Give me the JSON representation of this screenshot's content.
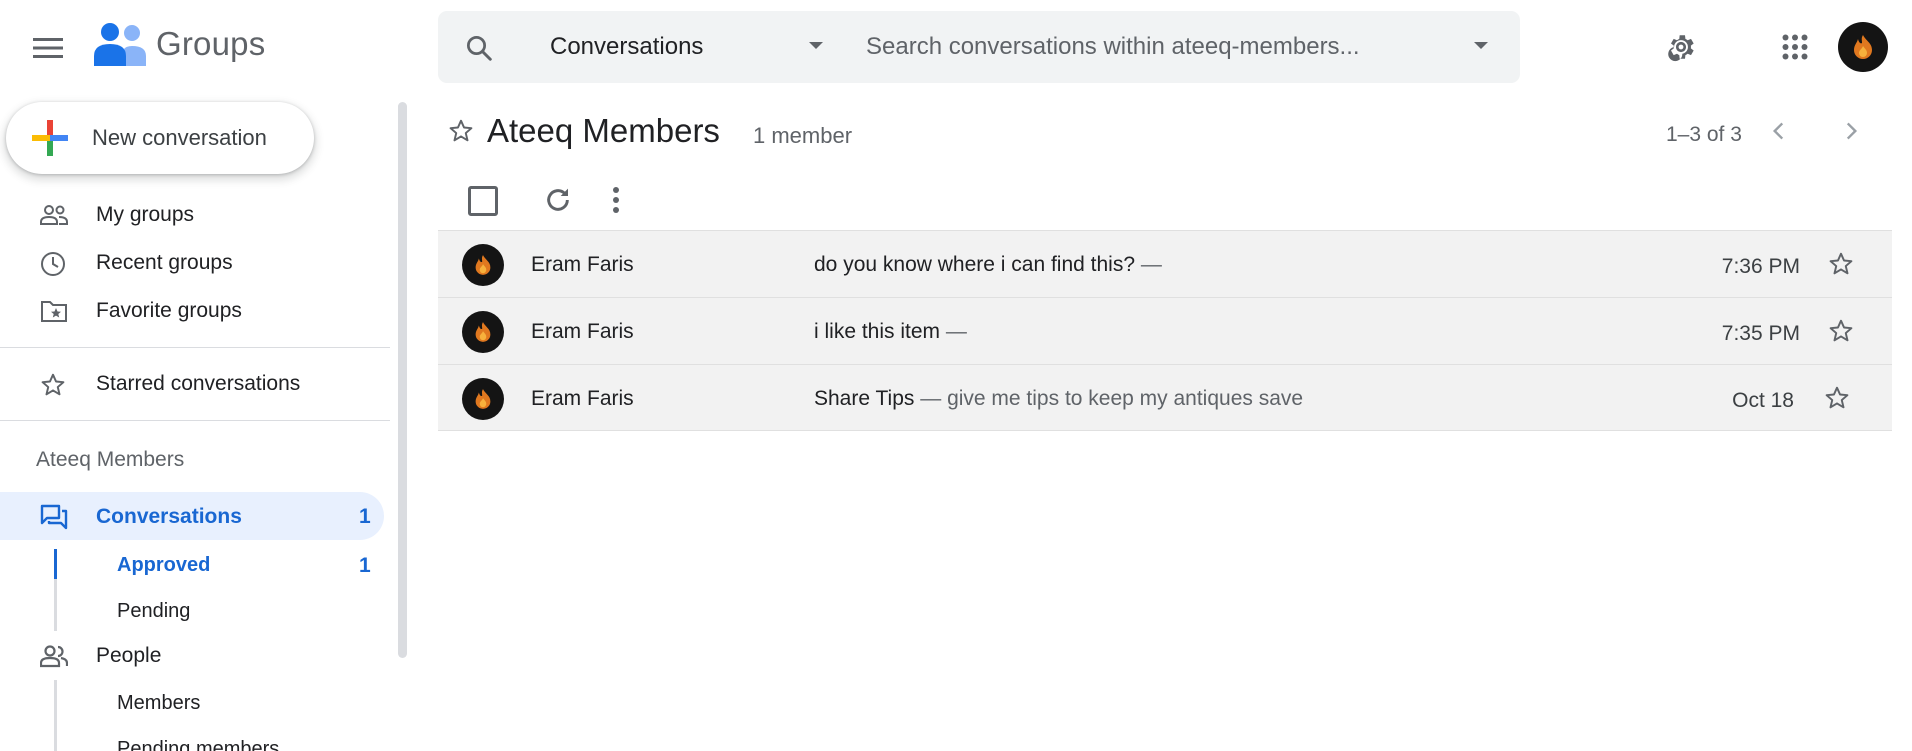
{
  "header": {
    "app_name": "Groups",
    "search_scope": "Conversations",
    "search_placeholder": "Search conversations within ateeq-members..."
  },
  "sidebar": {
    "new_conversation_label": "New conversation",
    "nav": [
      {
        "label": "My groups",
        "icon": "people-icon"
      },
      {
        "label": "Recent groups",
        "icon": "clock-icon"
      },
      {
        "label": "Favorite groups",
        "icon": "folder-star-icon"
      },
      {
        "label": "Starred conversations",
        "icon": "star-outline-icon"
      }
    ],
    "group_section_label": "Ateeq Members",
    "conversations": {
      "label": "Conversations",
      "count": "1"
    },
    "conversation_sub": [
      {
        "label": "Approved",
        "count": "1"
      },
      {
        "label": "Pending"
      }
    ],
    "people_label": "People",
    "people_sub": [
      {
        "label": "Members"
      },
      {
        "label": "Pending members"
      }
    ]
  },
  "main": {
    "group_title": "Ateeq Members",
    "member_count": "1 member",
    "pagination": "1–3 of 3",
    "threads": [
      {
        "author": "Eram Faris",
        "subject": "do you know where i can find this?",
        "separator": " —",
        "snippet": "",
        "time": "7:36 PM"
      },
      {
        "author": "Eram Faris",
        "subject": "i like this item",
        "separator": " —",
        "snippet": "",
        "time": "7:35 PM"
      },
      {
        "author": "Eram Faris",
        "subject": "Share Tips",
        "separator": " — ",
        "snippet": "give me tips to keep my antiques save",
        "time": "Oct 18"
      }
    ]
  },
  "colors": {
    "accent": "#1967d2",
    "active_bg": "#e8f0fe",
    "searchbar_bg": "#f1f3f4",
    "row_bg": "#f2f2f2"
  }
}
